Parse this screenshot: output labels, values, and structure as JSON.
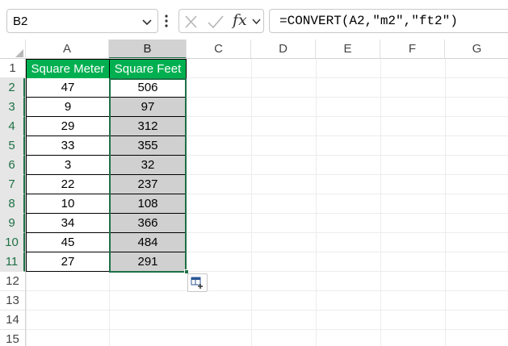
{
  "formula_bar": {
    "name_box": "B2",
    "fx_label": "fx",
    "formula": "=CONVERT(A2,\"m2\",\"ft2\")"
  },
  "columns": [
    "A",
    "B",
    "C",
    "D",
    "E",
    "F",
    "G"
  ],
  "rows": [
    "1",
    "2",
    "3",
    "4",
    "5",
    "6",
    "7",
    "8",
    "9",
    "10",
    "11",
    "12",
    "13",
    "14",
    "15"
  ],
  "table": {
    "headers": [
      "Square Meter",
      "Square Feet"
    ],
    "rows": [
      [
        "47",
        "506"
      ],
      [
        "9",
        "97"
      ],
      [
        "29",
        "312"
      ],
      [
        "33",
        "355"
      ],
      [
        "3",
        "32"
      ],
      [
        "22",
        "237"
      ],
      [
        "10",
        "108"
      ],
      [
        "34",
        "366"
      ],
      [
        "45",
        "484"
      ],
      [
        "27",
        "291"
      ]
    ]
  },
  "colors": {
    "header_fill": "#00b050",
    "selection": "#1e7145",
    "selected_fill": "#d0d0d0"
  },
  "icons": {
    "name_box_dropdown": "chevron-down-icon",
    "more": "more-vertical-icon",
    "cancel": "close-icon",
    "enter": "check-icon",
    "formula_dropdown": "chevron-down-icon",
    "quick_analysis": "quick-analysis-icon"
  }
}
